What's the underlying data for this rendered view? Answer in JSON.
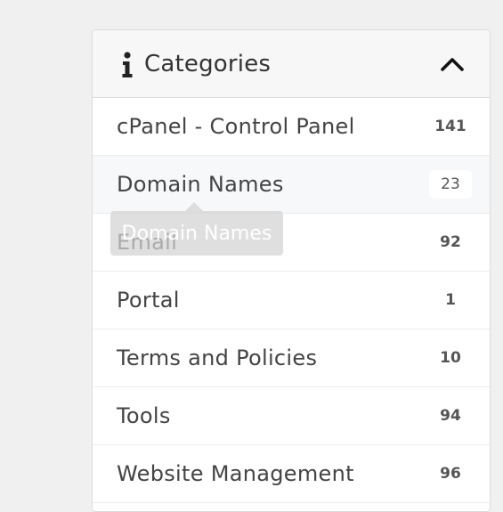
{
  "panel": {
    "title": "Categories",
    "icon": "info-icon",
    "toggle_icon": "chevron-up-icon"
  },
  "categories": [
    {
      "label": "cPanel - Control Panel",
      "count": "141"
    },
    {
      "label": "Domain Names",
      "count": "23"
    },
    {
      "label": "Email",
      "count": "92"
    },
    {
      "label": "Portal",
      "count": "1"
    },
    {
      "label": "Terms and Policies",
      "count": "10"
    },
    {
      "label": "Tools",
      "count": "94"
    },
    {
      "label": "Website Management",
      "count": "96"
    }
  ],
  "tooltip": {
    "text": "Domain Names"
  }
}
